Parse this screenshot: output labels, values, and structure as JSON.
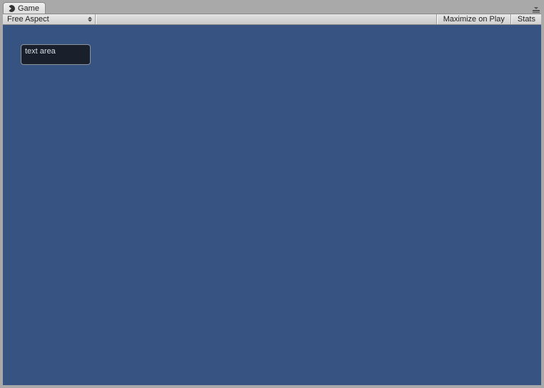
{
  "tab": {
    "label": "Game",
    "icon": "pacman-icon"
  },
  "toolbar": {
    "aspect_dropdown": {
      "selected": "Free Aspect"
    },
    "maximize_label": "Maximize on Play",
    "stats_label": "Stats"
  },
  "game_view": {
    "background_color": "#375381",
    "text_area": {
      "label": "text area"
    }
  }
}
